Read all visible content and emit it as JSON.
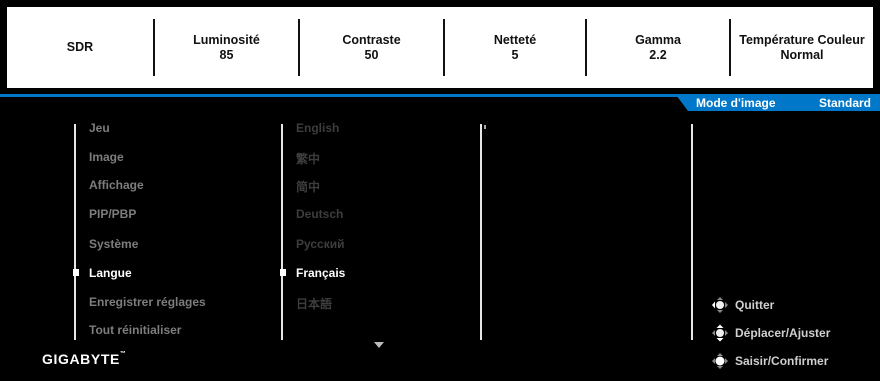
{
  "status_bar": [
    {
      "label": "SDR",
      "value": ""
    },
    {
      "label": "Luminosité",
      "value": "85"
    },
    {
      "label": "Contraste",
      "value": "50"
    },
    {
      "label": "Netteté",
      "value": "5"
    },
    {
      "label": "Gamma",
      "value": "2.2"
    },
    {
      "label": "Température Couleur",
      "value": "Normal"
    }
  ],
  "header_tab": {
    "label": "Mode d'image",
    "value": "Standard"
  },
  "menu": [
    {
      "label": "Jeu"
    },
    {
      "label": "Image"
    },
    {
      "label": "Affichage"
    },
    {
      "label": "PIP/PBP"
    },
    {
      "label": "Système"
    },
    {
      "label": "Langue",
      "selected": true
    },
    {
      "label": "Enregistrer réglages"
    },
    {
      "label": "Tout réinitialiser"
    }
  ],
  "languages": [
    {
      "label": "English"
    },
    {
      "label": "繁中"
    },
    {
      "label": "简中"
    },
    {
      "label": "Deutsch"
    },
    {
      "label": "Русский"
    },
    {
      "label": "Français",
      "selected": true
    },
    {
      "label": "日本語"
    }
  ],
  "hints": [
    {
      "label": "Quitter",
      "icon": "joystick-left-icon"
    },
    {
      "label": "Déplacer/Ajuster",
      "icon": "joystick-updown-icon"
    },
    {
      "label": "Saisir/Confirmer",
      "icon": "joystick-press-icon"
    }
  ],
  "brand": "GIGABYTE",
  "brand_mark": "™",
  "colors": {
    "accent": "#0077c8",
    "background": "#000000",
    "status_bar": "#ffffff"
  }
}
